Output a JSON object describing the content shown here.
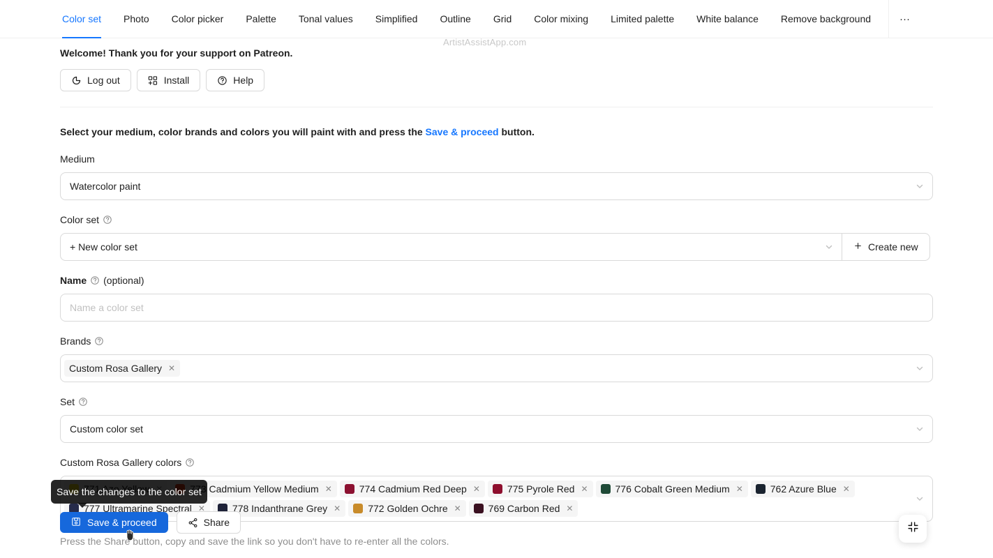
{
  "tabs": [
    {
      "label": "Color set",
      "active": true
    },
    {
      "label": "Photo",
      "active": false
    },
    {
      "label": "Color picker",
      "active": false
    },
    {
      "label": "Palette",
      "active": false
    },
    {
      "label": "Tonal values",
      "active": false
    },
    {
      "label": "Simplified",
      "active": false
    },
    {
      "label": "Outline",
      "active": false
    },
    {
      "label": "Grid",
      "active": false
    },
    {
      "label": "Color mixing",
      "active": false
    },
    {
      "label": "Limited palette",
      "active": false
    },
    {
      "label": "White balance",
      "active": false
    },
    {
      "label": "Remove background",
      "active": false
    }
  ],
  "tab_overflow_label": "···",
  "watermark": "ArtistAssistApp.com",
  "account": {
    "welcome": "Welcome! Thank you for your support on Patreon.",
    "buttons": [
      {
        "label": "Log out",
        "icon": "logout-icon"
      },
      {
        "label": "Install",
        "icon": "install-icon"
      },
      {
        "label": "Help",
        "icon": "question-circle-icon"
      }
    ]
  },
  "instructions": {
    "before": "Select your medium, color brands and colors you will paint with and press the ",
    "link": "Save & proceed",
    "after": " button."
  },
  "medium": {
    "label": "Medium",
    "value": "Watercolor paint"
  },
  "color_set": {
    "label": "Color set",
    "value": "+ New color set",
    "create_new_label": "Create new"
  },
  "name": {
    "label": "Name",
    "optional": "(optional)",
    "placeholder": "Name a color set",
    "value": ""
  },
  "brands": {
    "label": "Brands",
    "tags": [
      {
        "label": "Custom Rosa Gallery"
      }
    ]
  },
  "set": {
    "label": "Set",
    "value": "Custom color set"
  },
  "colors": {
    "label": "Custom Rosa Gallery colors",
    "tags": [
      {
        "label": "771 Azo Yellow",
        "color": "#FAE616"
      },
      {
        "label": "773 Cadmium Yellow Medium",
        "color": "#F03C17"
      },
      {
        "label": "774 Cadmium Red Deep",
        "color": "#8C1131"
      },
      {
        "label": "775 Pyrole Red",
        "color": "#8E0F2E"
      },
      {
        "label": "776 Cobalt Green Medium",
        "color": "#1F4A37"
      },
      {
        "label": "762 Azure Blue",
        "color": "#1B2430"
      },
      {
        "label": "777 Ultramarine Spectral",
        "color": "#262B4A"
      },
      {
        "label": "778 Indanthrane Grey",
        "color": "#1E2238"
      },
      {
        "label": "772 Golden Ochre",
        "color": "#C88B2A"
      },
      {
        "label": "769 Carbon Red",
        "color": "#3A1020"
      }
    ]
  },
  "tooltip": "Save the changes to the color set",
  "actions": {
    "save_label": "Save & proceed",
    "share_label": "Share"
  },
  "hint": "Press the Share button, copy and save the link so you don't have to re-enter all the colors.",
  "fab": "compress-icon",
  "theme": {
    "accent": "#1677ff",
    "primary_button": "#1668dc",
    "muted_text": "rgba(0,0,0,0.45)"
  }
}
